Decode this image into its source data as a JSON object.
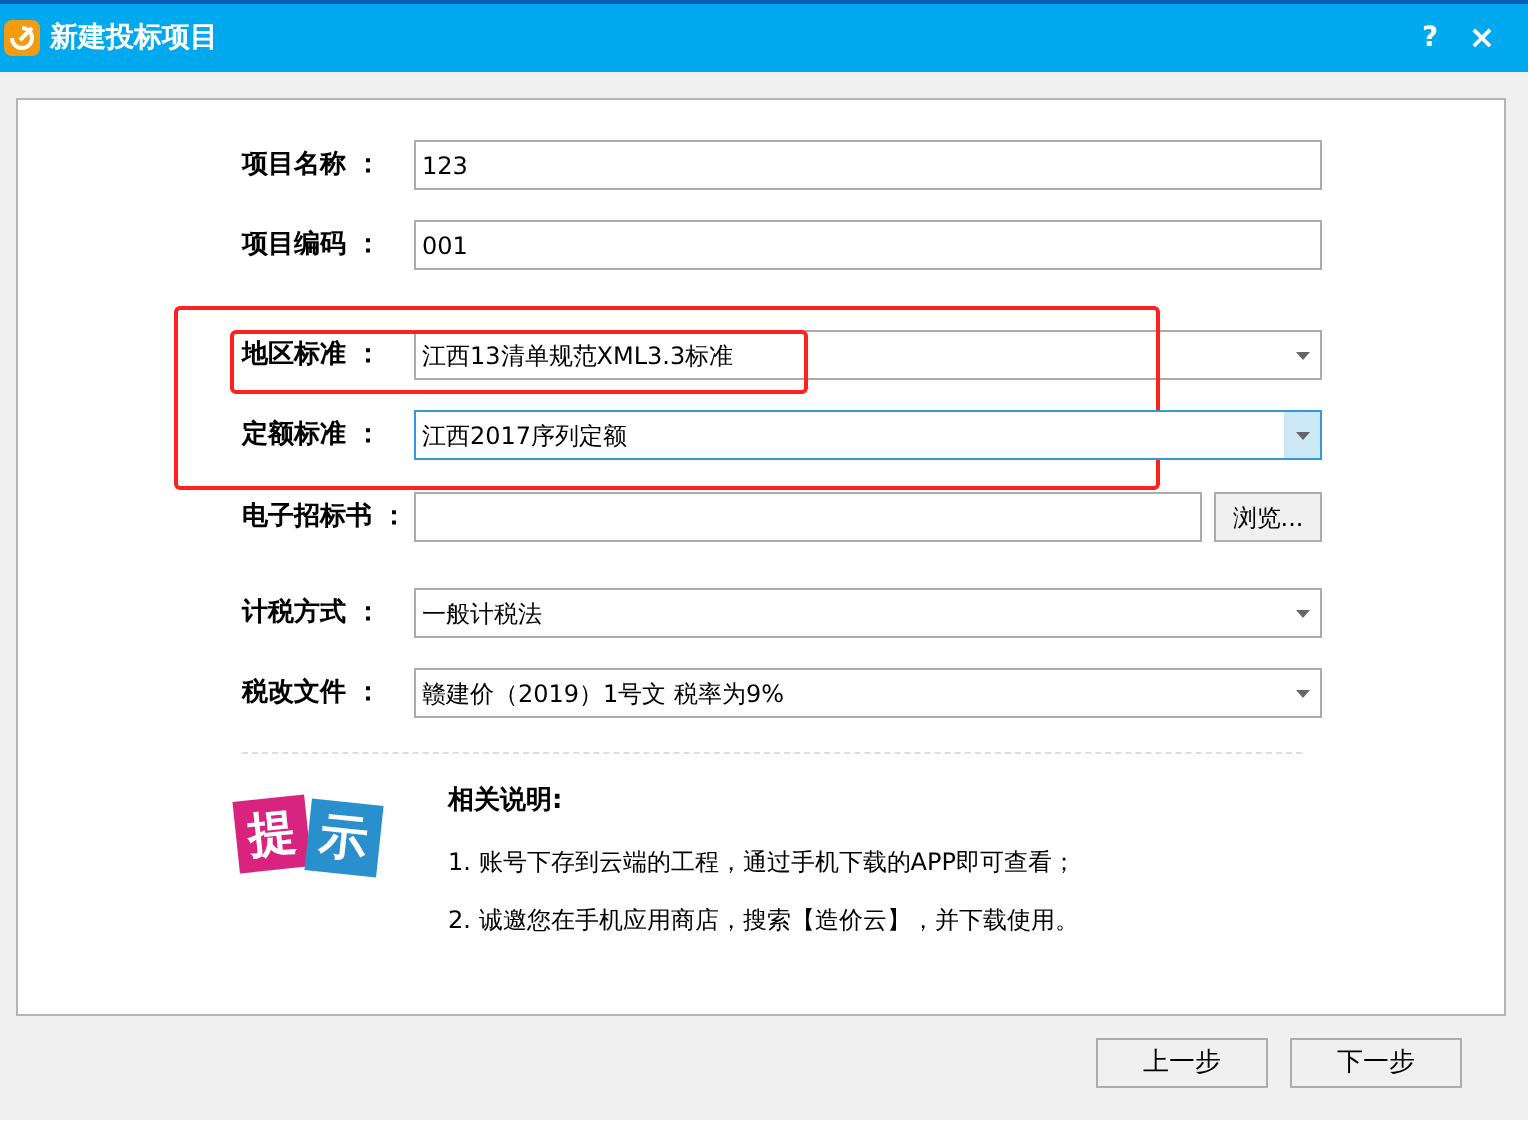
{
  "window": {
    "title": "新建投标项目",
    "help": "?",
    "close": "×"
  },
  "fields": [
    {
      "kind": "text",
      "label": "项目名称 ：",
      "value": "123",
      "boxed": false,
      "grouped": false
    },
    {
      "kind": "text",
      "label": "项目编码 ：",
      "value": "001",
      "boxed": false,
      "grouped": false
    },
    {
      "kind": "select",
      "label": "地区标准 ：",
      "value": "江西13清单规范XML3.3标准",
      "focused": false,
      "boxed": true,
      "grouped": true
    },
    {
      "kind": "select",
      "label": "定额标准 ：",
      "value": "江西2017序列定额",
      "focused": true,
      "boxed": false,
      "grouped": true
    },
    {
      "kind": "file",
      "label": "电子招标书 ：",
      "button": "浏览...",
      "boxed": false,
      "grouped": false
    },
    {
      "kind": "select",
      "label": "计税方式 ：",
      "value": "一般计税法",
      "focused": false,
      "boxed": false,
      "grouped": false
    },
    {
      "kind": "select",
      "label": "税改文件 ：",
      "value": "赣建价（2019）1号文 税率为9%",
      "focused": false,
      "boxed": false,
      "grouped": false
    }
  ],
  "hint": {
    "badge": [
      "提",
      "示"
    ],
    "title": "相关说明:",
    "items": [
      "1. 账号下存到云端的工程，通过手机下载的APP即可查看；",
      "2. 诚邀您在手机应用商店，搜索【造价云】，并下载使用。"
    ]
  },
  "buttons": [
    "上一步",
    "下一步"
  ]
}
